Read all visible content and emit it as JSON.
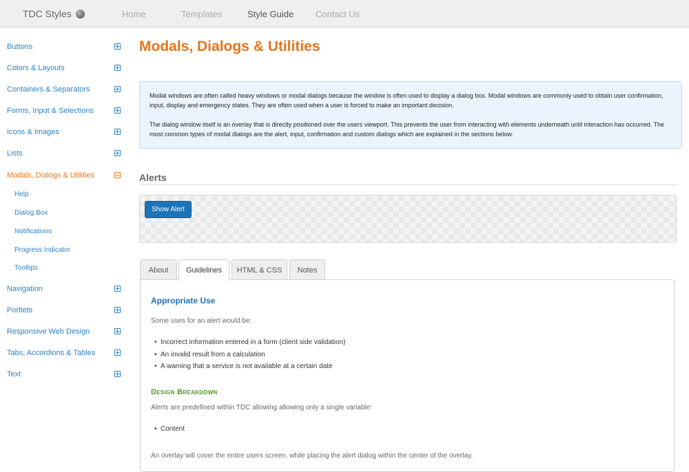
{
  "header": {
    "brand": "TDC Styles",
    "nav": [
      {
        "label": "Home",
        "active": false
      },
      {
        "label": "Templates",
        "active": false
      },
      {
        "label": "Style Guide",
        "active": true
      },
      {
        "label": "Contact Us",
        "active": false
      }
    ]
  },
  "sidebar": {
    "items": [
      {
        "label": "Buttons",
        "icon": "plus-box-icon"
      },
      {
        "label": "Colors & Layouts",
        "icon": "plus-box-icon"
      },
      {
        "label": "Containers & Separators",
        "icon": "plus-box-icon"
      },
      {
        "label": "Forms, Input & Selections",
        "icon": "plus-box-icon"
      },
      {
        "label": "Icons & Images",
        "icon": "plus-box-icon"
      },
      {
        "label": "Lists",
        "icon": "plus-box-icon"
      },
      {
        "label": "Modals, Dialogs & Utilities",
        "icon": "minus-box-icon",
        "active": true
      },
      {
        "label": "Navigation",
        "icon": "plus-box-icon"
      },
      {
        "label": "Portlets",
        "icon": "plus-box-icon"
      },
      {
        "label": "Responsive Web Design",
        "icon": "plus-box-icon"
      },
      {
        "label": "Tabs, Accordions & Tables",
        "icon": "plus-box-icon"
      },
      {
        "label": "Text",
        "icon": "plus-box-icon"
      }
    ],
    "subitems": [
      "Help",
      "Dialog Box",
      "Notifications",
      "Progress Indicator",
      "Tooltips"
    ]
  },
  "main": {
    "title": "Modals, Dialogs & Utilities",
    "intro": [
      "Modal windows are often called heavy windows or modal dialogs because the window is often used to display a dialog box. Modal windows are commonly used to obtain user confirmation, input, display and emergency states. They are often used when a user is forced to make an important decision.",
      "The dialog window itself is an overlay that is directly positioned over the users viewport. This prevents the user from interacting with elements underneath until interaction has occurred. The most common types of modal dialogs are the alert, input, confirmation and custom dialogs which are explained in the sections below."
    ],
    "section_title": "Alerts",
    "demo_button": "Show Alert",
    "tabs": [
      {
        "label": "About",
        "active": false
      },
      {
        "label": "Guidelines",
        "active": true
      },
      {
        "label": "HTML & CSS",
        "active": false
      },
      {
        "label": "Notes",
        "active": false
      }
    ],
    "guidelines": {
      "heading": "Appropriate Use",
      "lead": "Some uses for an alert would be:",
      "uses": [
        "Incorrect information entered in a form (client side validation)",
        "An invalid result from a calculation",
        "A warning that a service is not available at a certain date"
      ],
      "design_heading": "Design Breakdown",
      "design_text": "Alerts are predefined within TDC allowing allowing only a single variable:",
      "variables": [
        "Content"
      ],
      "overlay_text": "An overlay will cover the entire users screen, while placing the alert dialog within the center of the overlay."
    }
  },
  "colors": {
    "accent_orange": "#e8751a",
    "link_blue": "#2a82c8",
    "button_blue": "#1d73b8",
    "design_green": "#4a9b1f",
    "info_bg": "#eaf4fd"
  }
}
